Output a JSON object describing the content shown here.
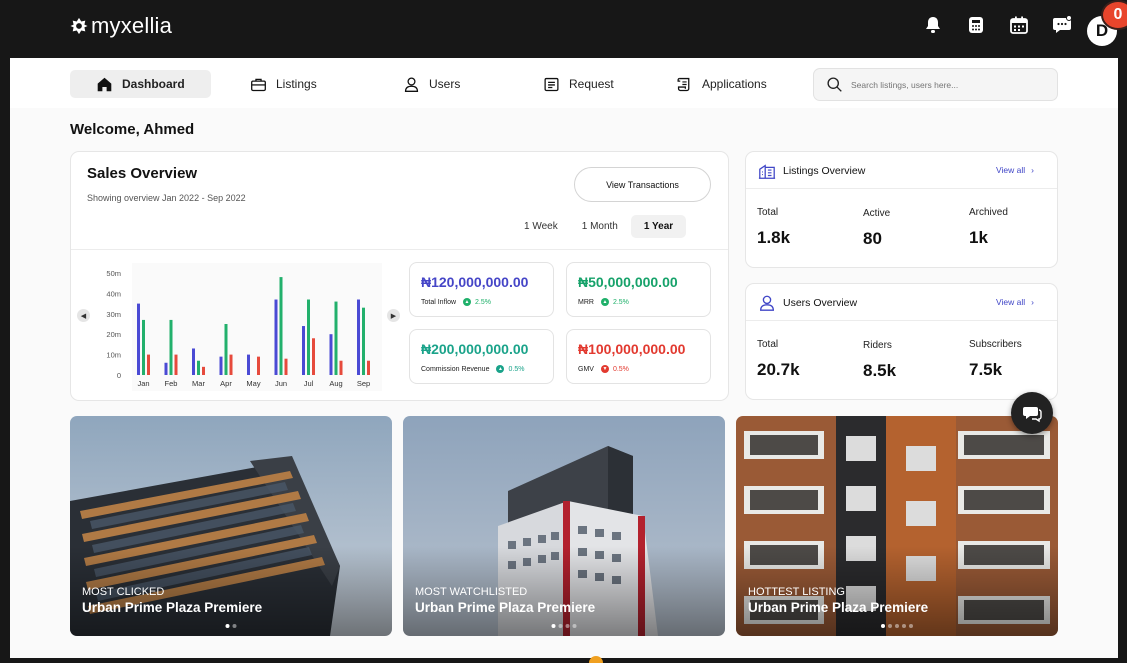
{
  "app": {
    "brand": "myxellia",
    "avatar_initial": "D",
    "notification_count": "0"
  },
  "nav": {
    "items": [
      {
        "label": "Dashboard",
        "icon": "home-icon",
        "active": true
      },
      {
        "label": "Listings",
        "icon": "briefcase-icon"
      },
      {
        "label": "Users",
        "icon": "user-icon"
      },
      {
        "label": "Request",
        "icon": "request-icon"
      },
      {
        "label": "Applications",
        "icon": "scroll-icon"
      }
    ],
    "search_placeholder": "Search listings, users here..."
  },
  "welcome": "Welcome, Ahmed",
  "sales": {
    "title": "Sales Overview",
    "subtitle": "Showing overview Jan 2022 - Sep 2022",
    "view_button": "View Transactions",
    "ranges": [
      "1 Week",
      "1 Month",
      "1 Year"
    ],
    "active_range": "1 Year",
    "metrics": [
      {
        "value": "₦120,000,000.00",
        "label": "Total Inflow",
        "change": "2.5%",
        "value_color": "#4545c7",
        "direction": "up"
      },
      {
        "value": "₦50,000,000.00",
        "label": "MRR",
        "change": "2.5%",
        "value_color": "#16a26a",
        "direction": "up"
      },
      {
        "value": "₦200,000,000.00",
        "label": "Commission Revenue",
        "change": "0.5%",
        "value_color": "#1aa38a",
        "direction": "up"
      },
      {
        "value": "₦100,000,000.00",
        "label": "GMV",
        "change": "0.5%",
        "value_color": "#e2392f",
        "direction": "down"
      }
    ]
  },
  "chart_data": {
    "type": "bar",
    "categories": [
      "Jan",
      "Feb",
      "Mar",
      "Apr",
      "May",
      "Jun",
      "Jul",
      "Aug",
      "Sep"
    ],
    "y_ticks": [
      "50m",
      "40m",
      "30m",
      "20m",
      "10m",
      "0"
    ],
    "ylim": [
      0,
      50
    ],
    "series": [
      {
        "color": "#4a4ad4",
        "values": [
          35,
          6,
          13,
          9,
          10,
          37,
          24,
          20,
          37
        ]
      },
      {
        "color": "#22b06c",
        "values": [
          27,
          27,
          7,
          25,
          0,
          48,
          37,
          36,
          33
        ]
      },
      {
        "color": "#e64a3c",
        "values": [
          10,
          10,
          4,
          10,
          9,
          8,
          18,
          7,
          7
        ]
      }
    ],
    "legend": "none",
    "grid": false
  },
  "listings_overview": {
    "title": "Listings Overview",
    "view_all": "View all",
    "stats": [
      {
        "label": "Total",
        "value": "1.8k"
      },
      {
        "label": "Active",
        "value": "80"
      },
      {
        "label": "Archived",
        "value": "1k"
      }
    ]
  },
  "users_overview": {
    "title": "Users Overview",
    "view_all": "View all",
    "stats": [
      {
        "label": "Total",
        "value": "20.7k"
      },
      {
        "label": "Riders",
        "value": "8.5k"
      },
      {
        "label": "Subscribers",
        "value": "7.5k"
      }
    ]
  },
  "properties": [
    {
      "tag": "MOST CLICKED",
      "name": "Urban Prime Plaza Premiere"
    },
    {
      "tag": "MOST WATCHLISTED",
      "name": "Urban Prime Plaza Premiere"
    },
    {
      "tag": "HOTTEST LISTING",
      "name": "Urban Prime Plaza Premiere"
    }
  ]
}
